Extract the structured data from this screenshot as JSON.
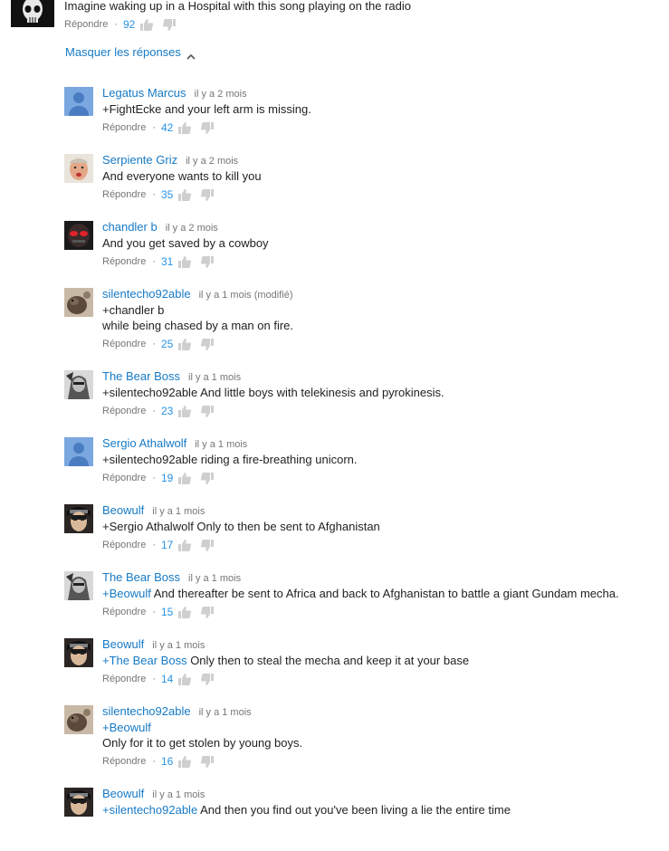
{
  "top_comment": {
    "text": "Imagine waking up in a Hospital with this song playing on the radio",
    "reply_label": "Répondre",
    "likes": "92"
  },
  "hide_replies_label": "Masquer les réponses",
  "replies": [
    {
      "author": "Legatus Marcus",
      "time": "il y a 2 mois",
      "mention": "",
      "text": "+FightEcke and your left arm is missing.",
      "likes": "42",
      "avatar": "default-blue"
    },
    {
      "author": "Serpiente Griz",
      "time": "il y a 2 mois",
      "mention": "",
      "text": "And everyone wants to kill you",
      "likes": "35",
      "avatar": "face"
    },
    {
      "author": "chandler b",
      "time": "il y a 2 mois",
      "mention": "",
      "text": "And you get saved by a cowboy",
      "likes": "31",
      "avatar": "mask"
    },
    {
      "author": "silentecho92able",
      "time": "il y a 1 mois (modifié)",
      "line1": "+chandler b",
      "text": "while being chased by a man on fire.",
      "likes": "25",
      "avatar": "animal"
    },
    {
      "author": "The Bear Boss",
      "time": "il y a 1 mois",
      "mention": "",
      "text": "+silentecho92able And little boys with telekinesis and pyrokinesis.",
      "likes": "23",
      "avatar": "soldier"
    },
    {
      "author": "Sergio Athalwolf",
      "time": "il y a 1 mois",
      "mention": "",
      "text": "+silentecho92able  riding a fire-breathing unicorn.",
      "likes": "19",
      "avatar": "default-blue"
    },
    {
      "author": "Beowulf",
      "time": "il y a 1 mois",
      "mention": "",
      "text": "+Sergio Athalwolf Only to then be sent to Afghanistan",
      "likes": "17",
      "avatar": "anime"
    },
    {
      "author": "The Bear Boss",
      "time": "il y a 1 mois",
      "mention": "+Beowulf",
      "text": " And thereafter be sent to Africa and back to Afghanistan to battle a giant Gundam mecha.",
      "likes": "15",
      "avatar": "soldier"
    },
    {
      "author": "Beowulf",
      "time": "il y a 1 mois",
      "mention": "+The Bear Boss",
      "text": " Only then to steal the mecha and keep it at your base",
      "likes": "14",
      "avatar": "anime"
    },
    {
      "author": "silentecho92able",
      "time": "il y a 1 mois",
      "line1": "+Beowulf",
      "text": "Only for it to get stolen by young boys.",
      "likes": "16",
      "avatar": "animal"
    },
    {
      "author": "Beowulf",
      "time": "il y a 1 mois",
      "mention": "+silentecho92able",
      "text": " And then you find out you've been living a lie the entire time",
      "likes": "",
      "avatar": "anime"
    }
  ],
  "reply_label": "Répondre",
  "colors": {
    "link": "#167ac6",
    "likes": "#2793e6",
    "meta": "#767676",
    "text": "#222222"
  },
  "icons": {
    "like": "thumbs-up-icon",
    "dislike": "thumbs-down-icon",
    "collapse": "chevron-up-icon"
  }
}
